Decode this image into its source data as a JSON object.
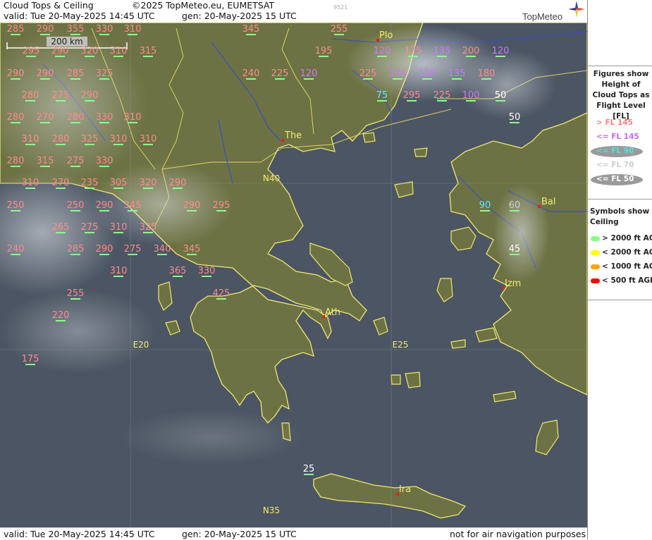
{
  "header": {
    "title": "Cloud Tops & Ceiling",
    "copyright": "©2025 TopMeteo.eu, EUMETSAT",
    "code": "9521",
    "valid": "valid:  Tue   20-May-2025  14:45 UTC",
    "generated": "gen: 20-May-2025 15 UTC",
    "logo": "TopMeteo"
  },
  "footer": {
    "valid": "valid:  Tue   20-May-2025  14:45 UTC",
    "generated": "gen: 20-May-2025 15 UTC",
    "disclaimer": "not for air navigation purposes"
  },
  "scale_bar": {
    "label": "200 km"
  },
  "grid_labels": [
    "N40",
    "N35",
    "E20",
    "E25"
  ],
  "cities": [
    {
      "name": "Plo"
    },
    {
      "name": "The"
    },
    {
      "name": "Bal"
    },
    {
      "name": "Ath"
    },
    {
      "name": "Izm"
    },
    {
      "name": "Ira"
    }
  ],
  "legend": {
    "title": "Figures show Height of Cloud Tops as Flight Level  [FL]",
    "levels": [
      {
        "label": "> FL 145",
        "color": "#ff8080"
      },
      {
        "label": "<= FL 145",
        "color": "#cc66ff"
      },
      {
        "label": "<= FL 90",
        "color": "#55e0e0"
      },
      {
        "label": "<= FL 70",
        "color": "#cccccc"
      },
      {
        "label": "<= FL 50",
        "color": "#ffffff"
      }
    ],
    "symbols_title": "Symbols show Ceiling",
    "symbols": [
      {
        "label": "> 2000 ft AGL",
        "color": "#88ff88"
      },
      {
        "label": "< 2000 ft AGL",
        "color": "#ffff00"
      },
      {
        "label": "< 1000 ft AGL",
        "color": "#ffa500"
      },
      {
        "label": "< 500 ft AGL",
        "color": "#ff0000"
      }
    ]
  },
  "cloud_tops": [
    {
      "fl": "285",
      "class": "high",
      "c": "g"
    },
    {
      "fl": "290",
      "class": "high",
      "c": "g"
    },
    {
      "fl": "355",
      "class": "high",
      "c": "g"
    },
    {
      "fl": "330",
      "class": "high",
      "c": "g"
    },
    {
      "fl": "310",
      "class": "high",
      "c": "g"
    },
    {
      "fl": "345",
      "class": "high",
      "c": "g"
    },
    {
      "fl": "255",
      "class": "high",
      "c": "g"
    },
    {
      "fl": "295",
      "class": "high",
      "c": "g"
    },
    {
      "fl": "290",
      "class": "high",
      "c": "g"
    },
    {
      "fl": "320",
      "class": "high",
      "c": "g"
    },
    {
      "fl": "310",
      "class": "high",
      "c": "g"
    },
    {
      "fl": "315",
      "class": "high",
      "c": "g"
    },
    {
      "fl": "195",
      "class": "high",
      "c": "g"
    },
    {
      "fl": "120",
      "class": "mid",
      "c": "g"
    },
    {
      "fl": "175",
      "class": "high",
      "c": "g"
    },
    {
      "fl": "135",
      "class": "mid",
      "c": "g"
    },
    {
      "fl": "200",
      "class": "high",
      "c": "g"
    },
    {
      "fl": "120",
      "class": "mid",
      "c": "g"
    },
    {
      "fl": "290",
      "class": "high",
      "c": "g"
    },
    {
      "fl": "290",
      "class": "high",
      "c": "g"
    },
    {
      "fl": "285",
      "class": "high",
      "c": "g"
    },
    {
      "fl": "325",
      "class": "high",
      "c": "g"
    },
    {
      "fl": "240",
      "class": "high",
      "c": "g"
    },
    {
      "fl": "225",
      "class": "high",
      "c": "g"
    },
    {
      "fl": "120",
      "class": "mid",
      "c": "g"
    },
    {
      "fl": "225",
      "class": "high",
      "c": "g"
    },
    {
      "fl": "130",
      "class": "mid",
      "c": "g"
    },
    {
      "fl": "130",
      "class": "mid",
      "c": "g"
    },
    {
      "fl": "135",
      "class": "mid",
      "c": "g"
    },
    {
      "fl": "180",
      "class": "high",
      "c": "g"
    },
    {
      "fl": "280",
      "class": "high",
      "c": "g"
    },
    {
      "fl": "275",
      "class": "high",
      "c": "g"
    },
    {
      "fl": "290",
      "class": "high",
      "c": "g"
    },
    {
      "fl": "75",
      "class": "low90",
      "c": "g"
    },
    {
      "fl": "295",
      "class": "high",
      "c": "g"
    },
    {
      "fl": "225",
      "class": "high",
      "c": "g"
    },
    {
      "fl": "100",
      "class": "mid",
      "c": "g"
    },
    {
      "fl": "50",
      "class": "low50",
      "c": "g"
    },
    {
      "fl": "280",
      "class": "high",
      "c": "g"
    },
    {
      "fl": "270",
      "class": "high",
      "c": "g"
    },
    {
      "fl": "280",
      "class": "high",
      "c": "g"
    },
    {
      "fl": "330",
      "class": "high",
      "c": "g"
    },
    {
      "fl": "310",
      "class": "high",
      "c": "g"
    },
    {
      "fl": "50",
      "class": "low50",
      "c": "g"
    },
    {
      "fl": "310",
      "class": "high",
      "c": "g"
    },
    {
      "fl": "280",
      "class": "high",
      "c": "g"
    },
    {
      "fl": "325",
      "class": "high",
      "c": "g"
    },
    {
      "fl": "310",
      "class": "high",
      "c": "g"
    },
    {
      "fl": "310",
      "class": "high",
      "c": "g"
    },
    {
      "fl": "280",
      "class": "high",
      "c": "g"
    },
    {
      "fl": "315",
      "class": "high",
      "c": "g"
    },
    {
      "fl": "275",
      "class": "high",
      "c": "g"
    },
    {
      "fl": "330",
      "class": "high",
      "c": "g"
    },
    {
      "fl": "310",
      "class": "high",
      "c": "g"
    },
    {
      "fl": "270",
      "class": "high",
      "c": "g"
    },
    {
      "fl": "235",
      "class": "high",
      "c": "g"
    },
    {
      "fl": "305",
      "class": "high",
      "c": "g"
    },
    {
      "fl": "320",
      "class": "high",
      "c": "g"
    },
    {
      "fl": "290",
      "class": "high",
      "c": "g"
    },
    {
      "fl": "250",
      "class": "high",
      "c": "g"
    },
    {
      "fl": "250",
      "class": "high",
      "c": "g"
    },
    {
      "fl": "290",
      "class": "high",
      "c": "g"
    },
    {
      "fl": "345",
      "class": "high",
      "c": "g"
    },
    {
      "fl": "290",
      "class": "high",
      "c": "g"
    },
    {
      "fl": "295",
      "class": "high",
      "c": "g"
    },
    {
      "fl": "90",
      "class": "low90",
      "c": "g"
    },
    {
      "fl": "60",
      "class": "low70",
      "c": "g"
    },
    {
      "fl": "265",
      "class": "high",
      "c": "g"
    },
    {
      "fl": "275",
      "class": "high",
      "c": "g"
    },
    {
      "fl": "310",
      "class": "high",
      "c": "g"
    },
    {
      "fl": "325",
      "class": "high",
      "c": "g"
    },
    {
      "fl": "240",
      "class": "high",
      "c": "g"
    },
    {
      "fl": "285",
      "class": "high",
      "c": "g"
    },
    {
      "fl": "290",
      "class": "high",
      "c": "g"
    },
    {
      "fl": "275",
      "class": "high",
      "c": "g"
    },
    {
      "fl": "340",
      "class": "high",
      "c": "g"
    },
    {
      "fl": "345",
      "class": "high",
      "c": "g"
    },
    {
      "fl": "45",
      "class": "low50",
      "c": "g"
    },
    {
      "fl": "310",
      "class": "high",
      "c": "g"
    },
    {
      "fl": "365",
      "class": "high",
      "c": "g"
    },
    {
      "fl": "330",
      "class": "high",
      "c": "g"
    },
    {
      "fl": "255",
      "class": "high",
      "c": "g"
    },
    {
      "fl": "425",
      "class": "high",
      "c": "g"
    },
    {
      "fl": "220",
      "class": "high",
      "c": "g"
    },
    {
      "fl": "175",
      "class": "high",
      "c": "g"
    },
    {
      "fl": "25",
      "class": "low50",
      "c": "g"
    }
  ],
  "colors": {
    "sea": "#4b5563",
    "land": "#6f7348",
    "coast": "#f0e870",
    "border": "#e8e060",
    "river": "#3b4fc0"
  }
}
